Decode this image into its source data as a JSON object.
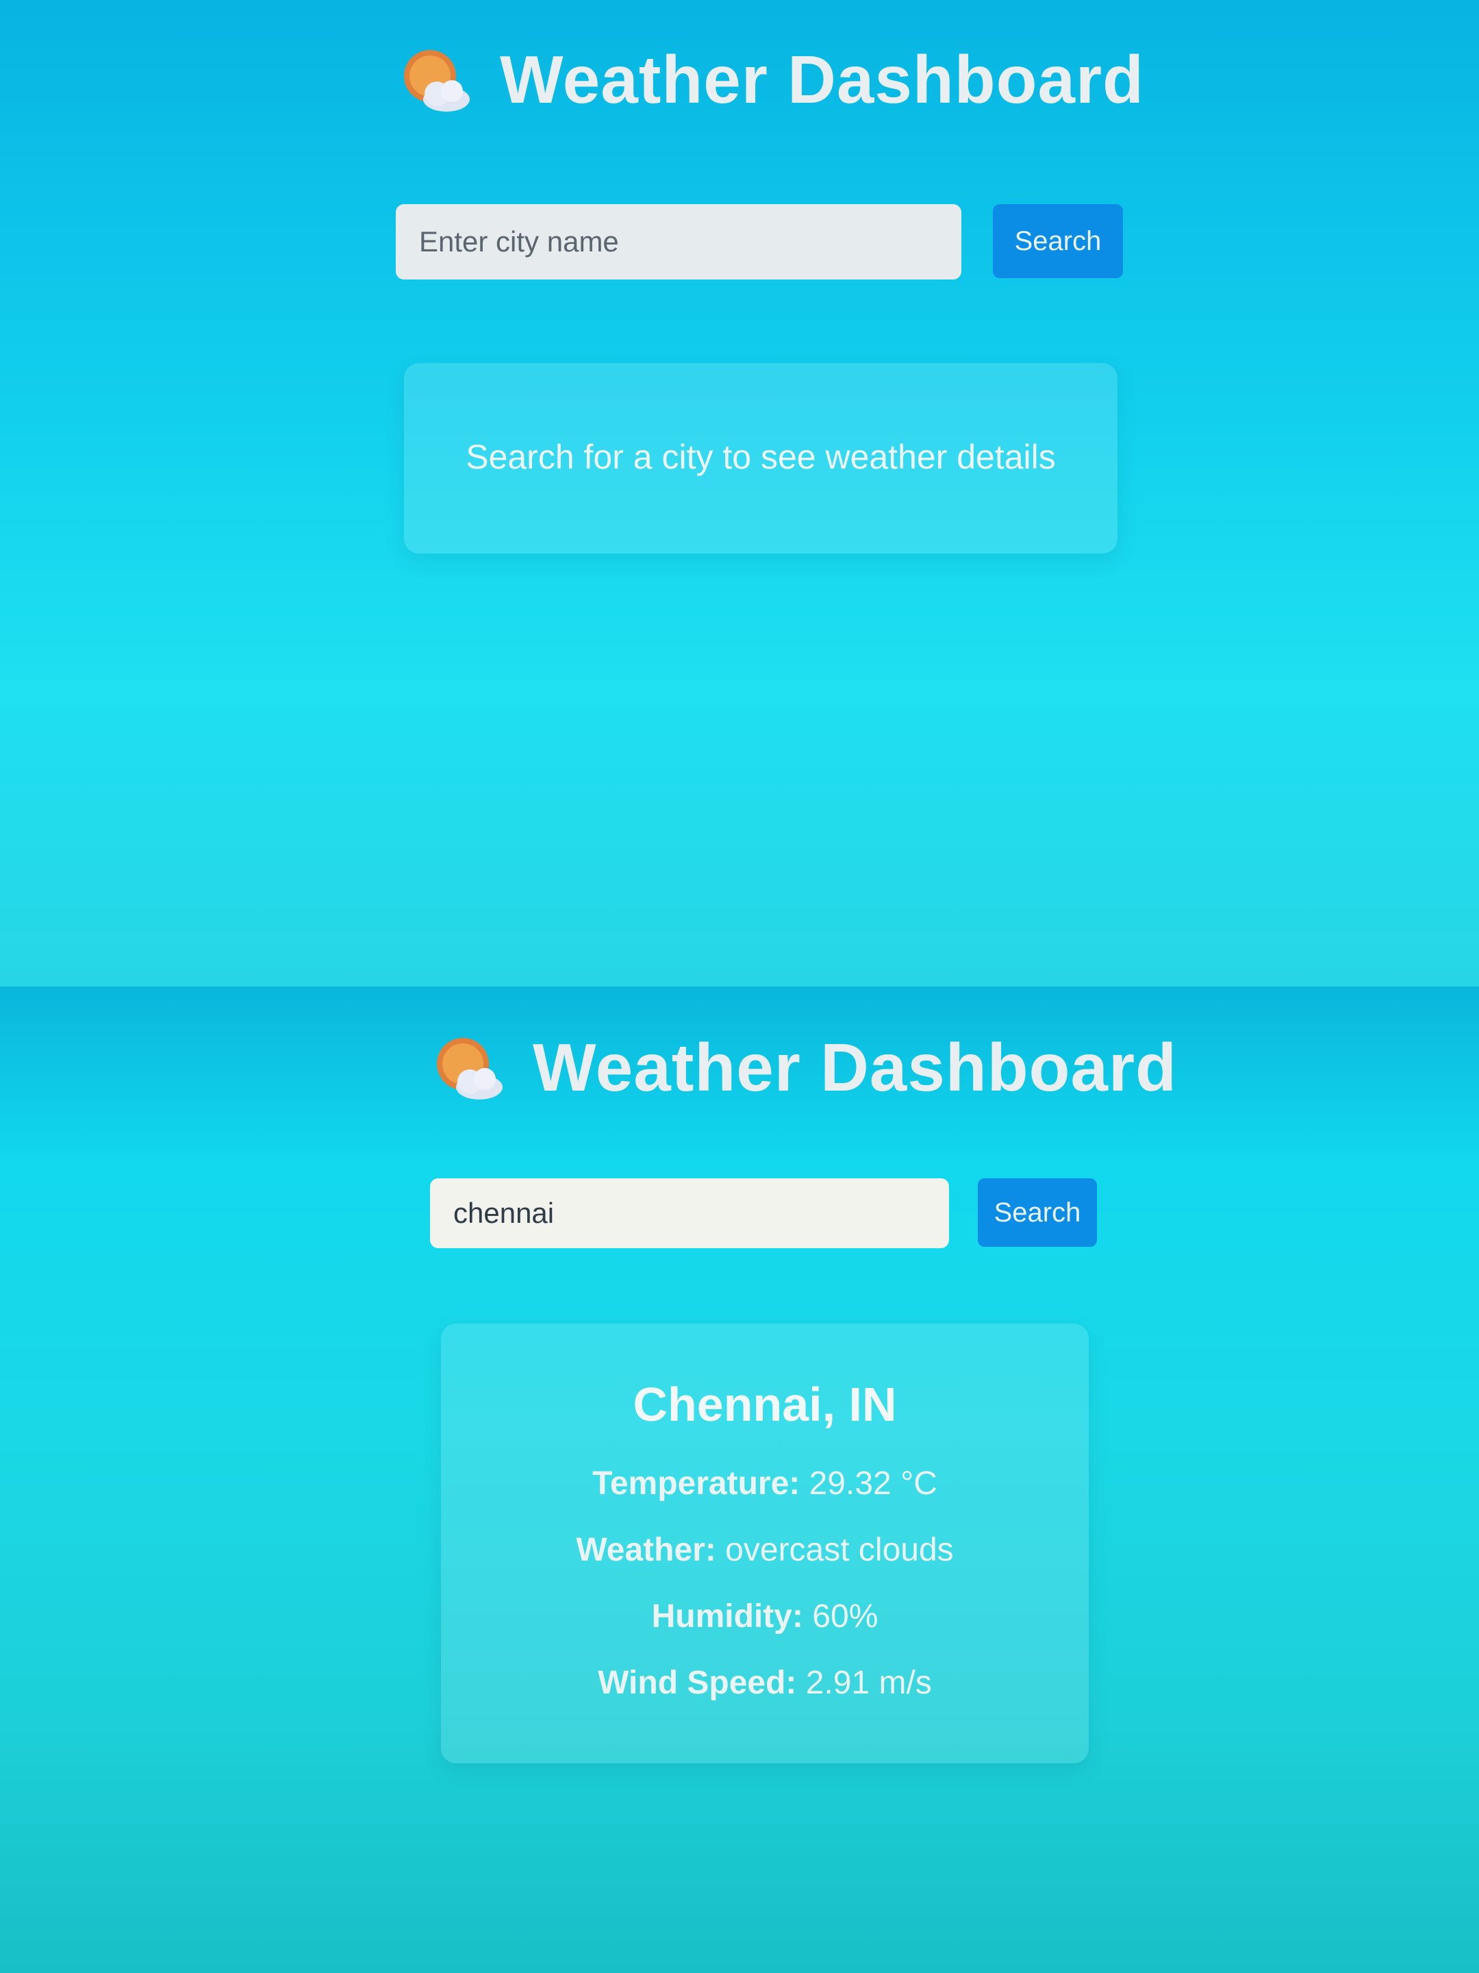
{
  "app": {
    "title": "Weather Dashboard",
    "icon": "sun-behind-cloud-icon"
  },
  "colors": {
    "button": "#0b8de6",
    "background_top": "#08b4e2",
    "background_bottom": "#1ccfd8"
  },
  "screen_empty": {
    "search": {
      "value": "",
      "placeholder": "Enter city name",
      "button_label": "Search"
    },
    "message": "Search for a city to see weather details"
  },
  "screen_result": {
    "search": {
      "value": "chennai",
      "placeholder": "Enter city name",
      "button_label": "Search"
    },
    "weather": {
      "city": "Chennai, IN",
      "temperature_label": "Temperature:",
      "temperature_value": "29.32 °C",
      "condition_label": "Weather:",
      "condition_value": "overcast clouds",
      "humidity_label": "Humidity:",
      "humidity_value": "60%",
      "wind_label": "Wind Speed:",
      "wind_value": "2.91 m/s"
    }
  }
}
